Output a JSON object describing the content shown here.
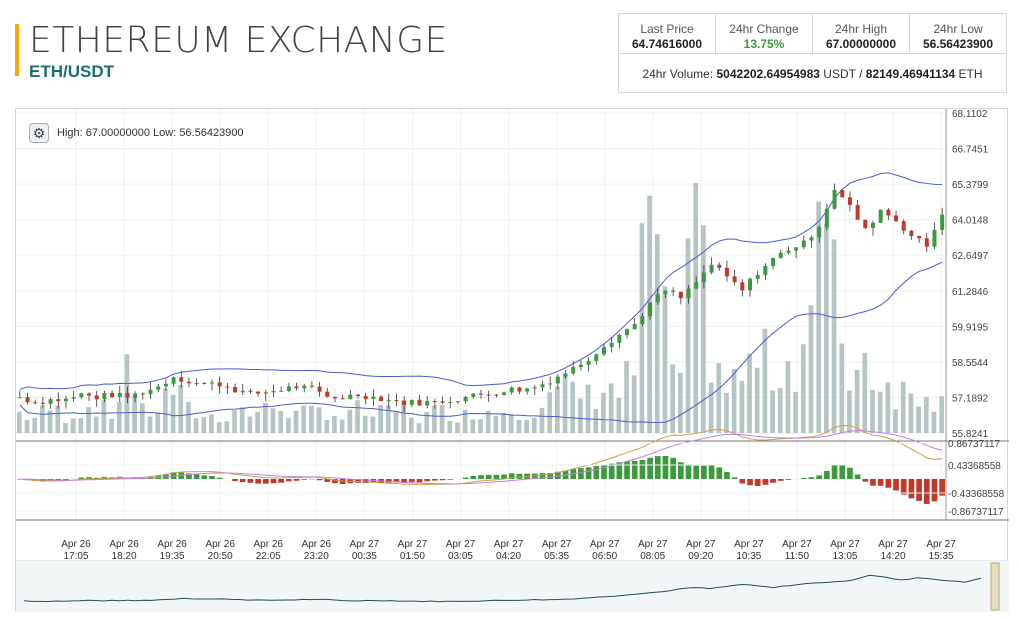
{
  "header": {
    "title": "ETHEREUM EXCHANGE",
    "pair": "ETH/USDT"
  },
  "stats": {
    "last_price_label": "Last Price",
    "last_price": "64.74616000",
    "change_label": "24hr Change",
    "change": "13.75%",
    "high_label": "24hr High",
    "high": "67.00000000",
    "low_label": "24hr Low",
    "low": "56.56423900",
    "volume_label": "24hr Volume:",
    "volume_usdt": "5042202.64954983",
    "usdt": "USDT /",
    "volume_eth": "82149.46941134",
    "eth": "ETH"
  },
  "chart": {
    "high_low_text": "High: 67.00000000  Low: 56.56423900",
    "price_ticks": [
      "68.1102",
      "66.7451",
      "65.3799",
      "64.0148",
      "62.6497",
      "61.2846",
      "59.9195",
      "58.5544",
      "57.1892",
      "55.8241"
    ],
    "macd_ticks": [
      "0.86737117",
      "0.43368558",
      "-0.43368558",
      "-0.86737117"
    ],
    "time_labels": [
      [
        "Apr 26",
        "17:05"
      ],
      [
        "Apr 26",
        "18:20"
      ],
      [
        "Apr 26",
        "19:35"
      ],
      [
        "Apr 26",
        "20:50"
      ],
      [
        "Apr 26",
        "22:05"
      ],
      [
        "Apr 26",
        "23:20"
      ],
      [
        "Apr 27",
        "00:35"
      ],
      [
        "Apr 27",
        "01:50"
      ],
      [
        "Apr 27",
        "03:05"
      ],
      [
        "Apr 27",
        "04:20"
      ],
      [
        "Apr 27",
        "05:35"
      ],
      [
        "Apr 27",
        "06:50"
      ],
      [
        "Apr 27",
        "08:05"
      ],
      [
        "Apr 27",
        "09:20"
      ],
      [
        "Apr 27",
        "10:35"
      ],
      [
        "Apr 27",
        "11:50"
      ],
      [
        "Apr 27",
        "13:05"
      ],
      [
        "Apr 27",
        "14:20"
      ],
      [
        "Apr 27",
        "15:35"
      ]
    ],
    "price_range": [
      55.8241,
      68.1102
    ],
    "closes": [
      57.2,
      57.0,
      57.1,
      57.1,
      57.3,
      57.2,
      57.3,
      57.2,
      57.4,
      57.6,
      58.0,
      57.8,
      57.7,
      57.7,
      57.5,
      57.3,
      57.4,
      57.5,
      57.6,
      57.5,
      57.2,
      57.2,
      57.3,
      57.2,
      57.1,
      57.0,
      57.0,
      57.0,
      57.1,
      57.2,
      57.3,
      57.4,
      57.5,
      57.5,
      57.7,
      58.0,
      58.3,
      58.7,
      59.2,
      59.6,
      60.0,
      60.8,
      61.3,
      61.0,
      61.6,
      62.3,
      61.8,
      61.3,
      62.0,
      62.5,
      62.9,
      63.1,
      63.8,
      65.2,
      64.5,
      63.6,
      64.4,
      64.0,
      63.4,
      63.0,
      64.3
    ],
    "volumes": [
      8,
      6,
      10,
      7,
      9,
      12,
      6,
      30,
      8,
      10,
      18,
      9,
      7,
      6,
      10,
      8,
      9,
      12,
      7,
      8,
      10,
      6,
      9,
      7,
      8,
      10,
      6,
      8,
      9,
      7,
      10,
      8,
      12,
      9,
      11,
      15,
      18,
      14,
      20,
      16,
      25,
      95,
      40,
      20,
      90,
      35,
      18,
      22,
      30,
      26,
      28,
      35,
      80,
      55,
      25,
      30,
      22,
      18,
      15,
      20,
      12
    ],
    "colors": {
      "up": "#3c9a3c",
      "down": "#c0392b",
      "band": "#4a5bd0",
      "volume": "#b7c4c4",
      "grid": "#eef0f2",
      "macd1": "#c8a24a",
      "macd2": "#c77ee0",
      "nav": "#1f4f55"
    }
  }
}
